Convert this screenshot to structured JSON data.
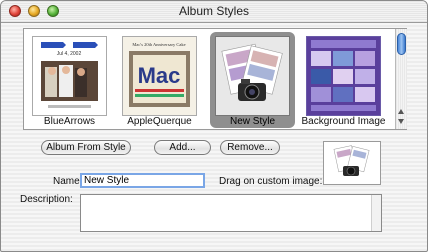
{
  "window": {
    "title": "Album Styles"
  },
  "styles": [
    {
      "label": "BlueArrows",
      "selected": false
    },
    {
      "label": "AppleQuerque",
      "selected": false
    },
    {
      "label": "New Style",
      "selected": true
    },
    {
      "label": "Background Image",
      "selected": false
    }
  ],
  "buttons": {
    "album_from_style": "Album From Style",
    "add": "Add...",
    "remove": "Remove..."
  },
  "form": {
    "name_label": "Name:",
    "name_value": "New Style",
    "description_label": "Description:",
    "description_value": "",
    "custom_image_label": "Drag on custom image:"
  },
  "thumb_text": {
    "bluearrows_title": "Jul 4, 2002",
    "applequerque_heading": "Mac's 20th Anniversary Cake",
    "applequerque_word": "Mac"
  },
  "colors": {
    "selection": "#8f8f8f",
    "field_focus": "#7aa6e6",
    "scroll_accent": "#4a86d8"
  }
}
